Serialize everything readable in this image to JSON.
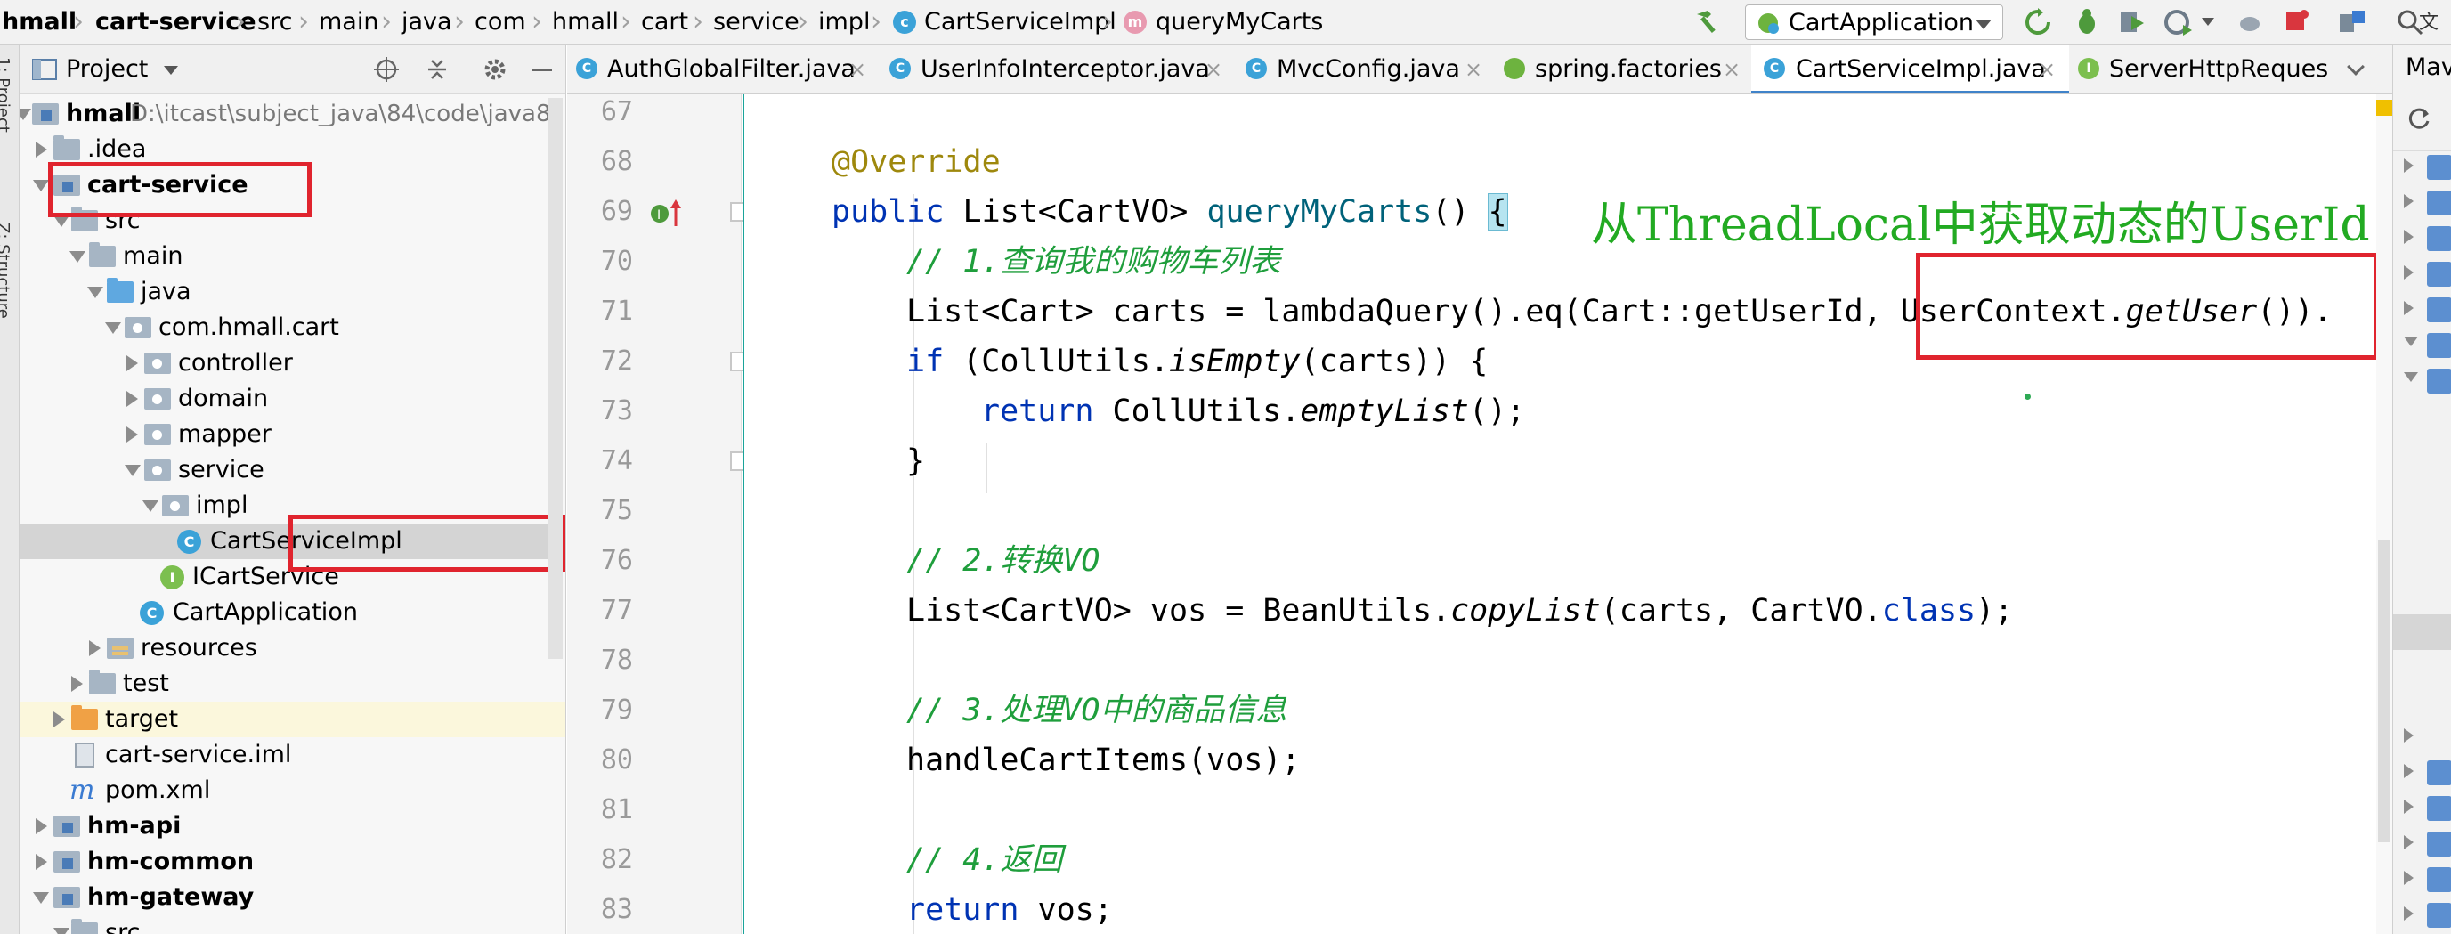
{
  "breadcrumb": [
    "hmall",
    "cart-service",
    "src",
    "main",
    "java",
    "com",
    "hmall",
    "cart",
    "service",
    "impl",
    "CartServiceImpl",
    "queryMyCarts"
  ],
  "breadcrumb_badges": {
    "class": "c",
    "method": "m"
  },
  "run_config": "CartApplication",
  "left_strip": {
    "project": "1: Project",
    "structure": "Z: Structure"
  },
  "project_panel": {
    "title": "Project"
  },
  "tree": [
    {
      "label": "hmall",
      "path": "D:\\itcast\\subject_java\\84\\code\\java8"
    },
    {
      "label": ".idea"
    },
    {
      "label": "cart-service"
    },
    {
      "label": "src"
    },
    {
      "label": "main"
    },
    {
      "label": "java"
    },
    {
      "label": "com.hmall.cart"
    },
    {
      "label": "controller"
    },
    {
      "label": "domain"
    },
    {
      "label": "mapper"
    },
    {
      "label": "service"
    },
    {
      "label": "impl"
    },
    {
      "label": "CartServiceImpl"
    },
    {
      "label": "ICartService"
    },
    {
      "label": "CartApplication"
    },
    {
      "label": "resources"
    },
    {
      "label": "test"
    },
    {
      "label": "target"
    },
    {
      "label": "cart-service.iml"
    },
    {
      "label": "pom.xml"
    },
    {
      "label": "hm-api"
    },
    {
      "label": "hm-common"
    },
    {
      "label": "hm-gateway"
    },
    {
      "label": "src"
    }
  ],
  "tree_badges": {
    "class": "C",
    "interface": "I",
    "maven": "m"
  },
  "tabs": [
    {
      "label": "AuthGlobalFilter.java",
      "badge": "C"
    },
    {
      "label": "UserInfoInterceptor.java",
      "badge": "C"
    },
    {
      "label": "MvcConfig.java",
      "badge": "C"
    },
    {
      "label": "spring.factories",
      "badge": ""
    },
    {
      "label": "CartServiceImpl.java",
      "badge": "C"
    },
    {
      "label": "ServerHttpRequest.c",
      "badge": "I"
    }
  ],
  "tab_close": "×",
  "tab_overflow": "Mav",
  "line_numbers": [
    "67",
    "68",
    "69",
    "70",
    "71",
    "72",
    "73",
    "74",
    "75",
    "76",
    "77",
    "78",
    "79",
    "80",
    "81",
    "82",
    "83"
  ],
  "code": {
    "l68": "@Override",
    "l69_kw": "public",
    "l69_type": " List<CartVO> ",
    "l69_meth": "queryMyCarts",
    "l69_paren": "() ",
    "l69_brace": "{",
    "l70": "// 1.查询我的购物车列表",
    "l71_a": "List<Cart> carts = lambdaQuery().eq(Cart::getUserId, UserContext.",
    "l71_b": "getUser",
    "l71_c": "()).",
    "l72_kw": "if",
    "l72_a": " (CollUtils.",
    "l72_b": "isEmpty",
    "l72_c": "(carts)) {",
    "l73_kw": "return",
    "l73_a": " CollUtils.",
    "l73_b": "emptyList",
    "l73_c": "();",
    "l74": "}",
    "l76": "// 2.转换VO",
    "l77_a": "List<CartVO> vos = BeanUtils.",
    "l77_b": "copyList",
    "l77_c": "(carts, CartVO.",
    "l77_kw": "class",
    "l77_d": ");",
    "l79": "// 3.处理VO中的商品信息",
    "l80": "handleCartItems(vos);",
    "l82": "// 4.返回",
    "l83_kw": "return",
    "l83_a": " vos;"
  },
  "annotation_note": "从ThreadLocal中获取动态的UserId",
  "colors": {
    "highlight_box": "#e0242e",
    "note": "#22aa22",
    "keyword": "#0033b3",
    "annotation": "#9e880d",
    "method": "#00627a"
  }
}
